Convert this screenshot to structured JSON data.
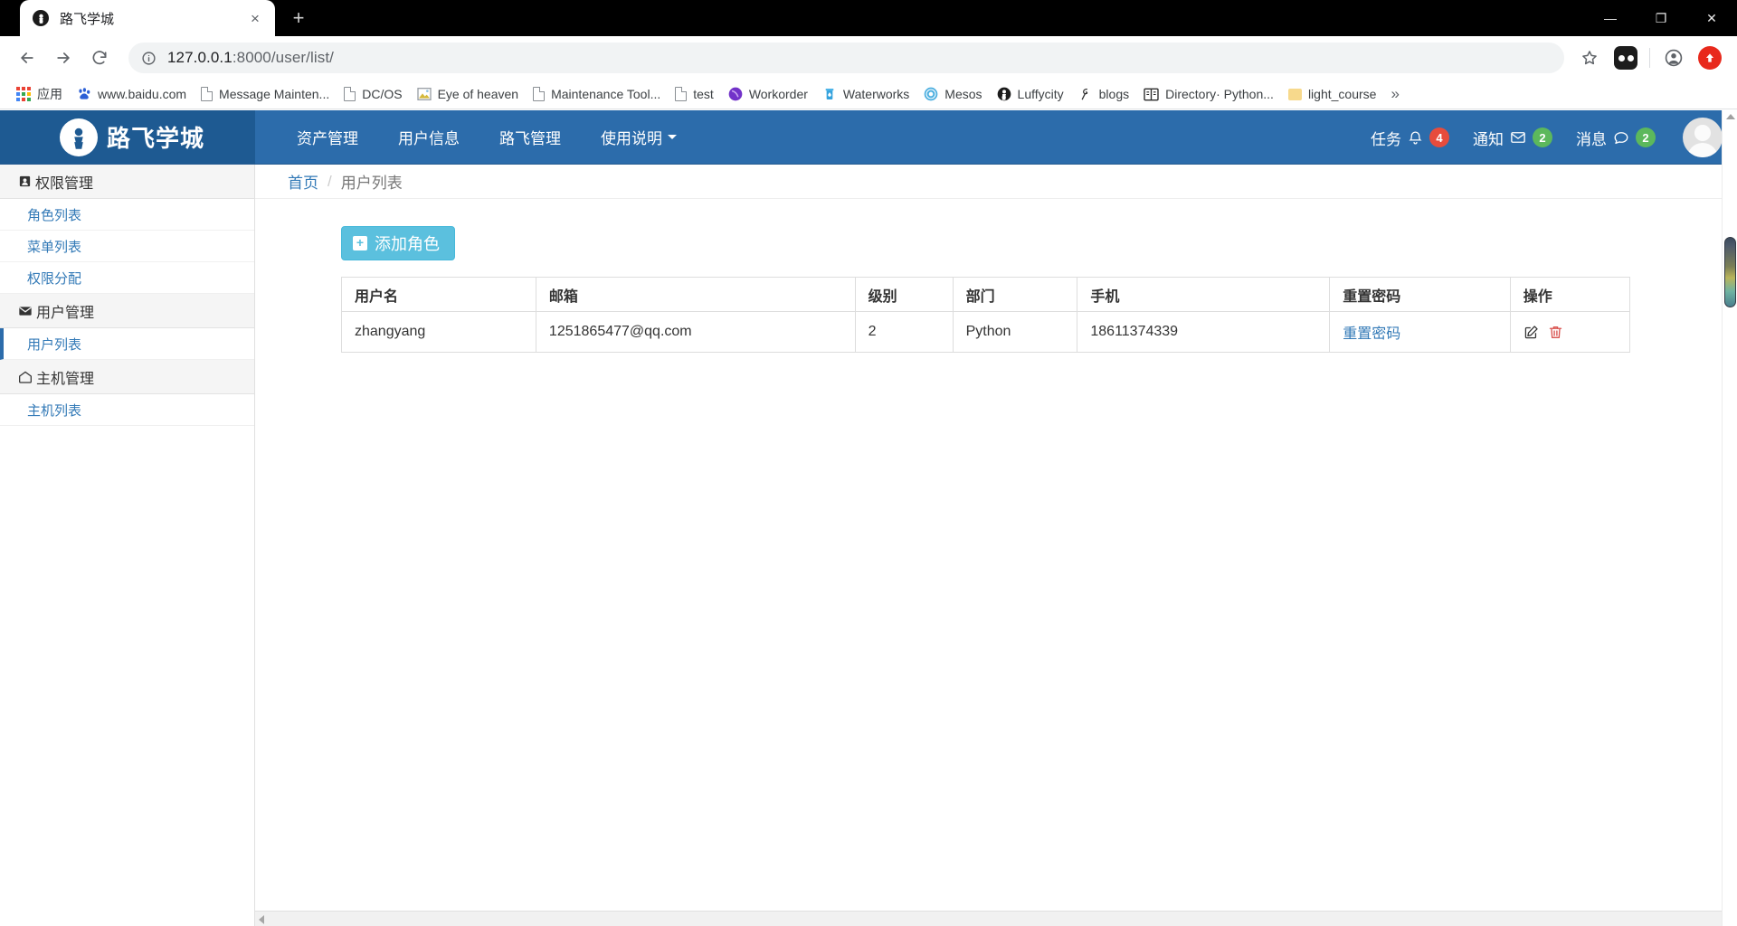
{
  "browser": {
    "tab": {
      "title": "路飞学城",
      "favicon": "luffy-icon",
      "close": "×"
    },
    "new_tab": "+",
    "window_controls": {
      "minimize": "—",
      "maximize": "❐",
      "close": "✕"
    },
    "nav": {
      "back": "←",
      "forward": "→",
      "reload": "⟳"
    },
    "address": {
      "info_icon": "info-icon",
      "host": "127.0.0.1",
      "rest": ":8000/user/list/"
    },
    "toolbar_icons": [
      "star-icon",
      "extension-icon",
      "profile-icon",
      "update-icon"
    ],
    "bookmarks": [
      {
        "label": "应用",
        "icon": "apps-grid-icon"
      },
      {
        "label": "www.baidu.com",
        "icon": "baidu-icon"
      },
      {
        "label": "Message Mainten...",
        "icon": "document-icon"
      },
      {
        "label": "DC/OS",
        "icon": "document-icon"
      },
      {
        "label": "Eye of heaven",
        "icon": "image-icon"
      },
      {
        "label": "Maintenance Tool...",
        "icon": "document-icon"
      },
      {
        "label": "test",
        "icon": "document-icon"
      },
      {
        "label": "Workorder",
        "icon": "workorder-icon"
      },
      {
        "label": "Waterworks",
        "icon": "waterworks-icon"
      },
      {
        "label": "Mesos",
        "icon": "mesos-icon"
      },
      {
        "label": "Luffycity",
        "icon": "luffy-icon"
      },
      {
        "label": "blogs",
        "icon": "blogs-icon"
      },
      {
        "label": "Directory· Python...",
        "icon": "book-icon"
      },
      {
        "label": "light_course",
        "icon": "folder-icon"
      }
    ],
    "bookmarks_overflow": "»"
  },
  "app": {
    "brand": "路飞学城",
    "nav_links": [
      {
        "label": "资产管理",
        "caret": false
      },
      {
        "label": "用户信息",
        "caret": false
      },
      {
        "label": "路飞管理",
        "caret": false
      },
      {
        "label": "使用说明",
        "caret": true
      }
    ],
    "nav_right": [
      {
        "label": "任务",
        "icon": "bell-icon",
        "count": "4",
        "color": "#e74c3c"
      },
      {
        "label": "通知",
        "icon": "envelope-icon",
        "count": "2",
        "color": "#5cb85c"
      },
      {
        "label": "消息",
        "icon": "comment-icon",
        "count": "2",
        "color": "#5cb85c"
      }
    ],
    "avatar": "user-avatar"
  },
  "sidebar": {
    "groups": [
      {
        "title": "权限管理",
        "icon": "id-card-icon",
        "items": [
          {
            "label": "角色列表",
            "active": false
          },
          {
            "label": "菜单列表",
            "active": false
          },
          {
            "label": "权限分配",
            "active": false
          }
        ]
      },
      {
        "title": "用户管理",
        "icon": "envelope-icon",
        "items": [
          {
            "label": "用户列表",
            "active": true
          }
        ]
      },
      {
        "title": "主机管理",
        "icon": "envelope-open-icon",
        "items": [
          {
            "label": "主机列表",
            "active": false
          }
        ]
      }
    ]
  },
  "main": {
    "breadcrumb": {
      "home": "首页",
      "separator": "/",
      "current": "用户列表"
    },
    "add_button": {
      "label": "添加角色",
      "icon": "plus-square-icon"
    },
    "table": {
      "columns": [
        "用户名",
        "邮箱",
        "级别",
        "部门",
        "手机",
        "重置密码",
        "操作"
      ],
      "rows": [
        {
          "username": "zhangyang",
          "email": "1251865477@qq.com",
          "level": "2",
          "department": "Python",
          "phone": "18611374339",
          "reset_password": "重置密码",
          "actions": {
            "edit": "edit-icon",
            "delete": "trash-icon"
          }
        }
      ]
    }
  },
  "colors": {
    "navbar": "#2c6cab",
    "brand_bg": "#1e5a92",
    "link": "#337ab7",
    "add_button": "#5bc0de",
    "badge_red": "#e74c3c",
    "badge_green": "#5cb85c",
    "delete_icon": "#d9534f"
  }
}
